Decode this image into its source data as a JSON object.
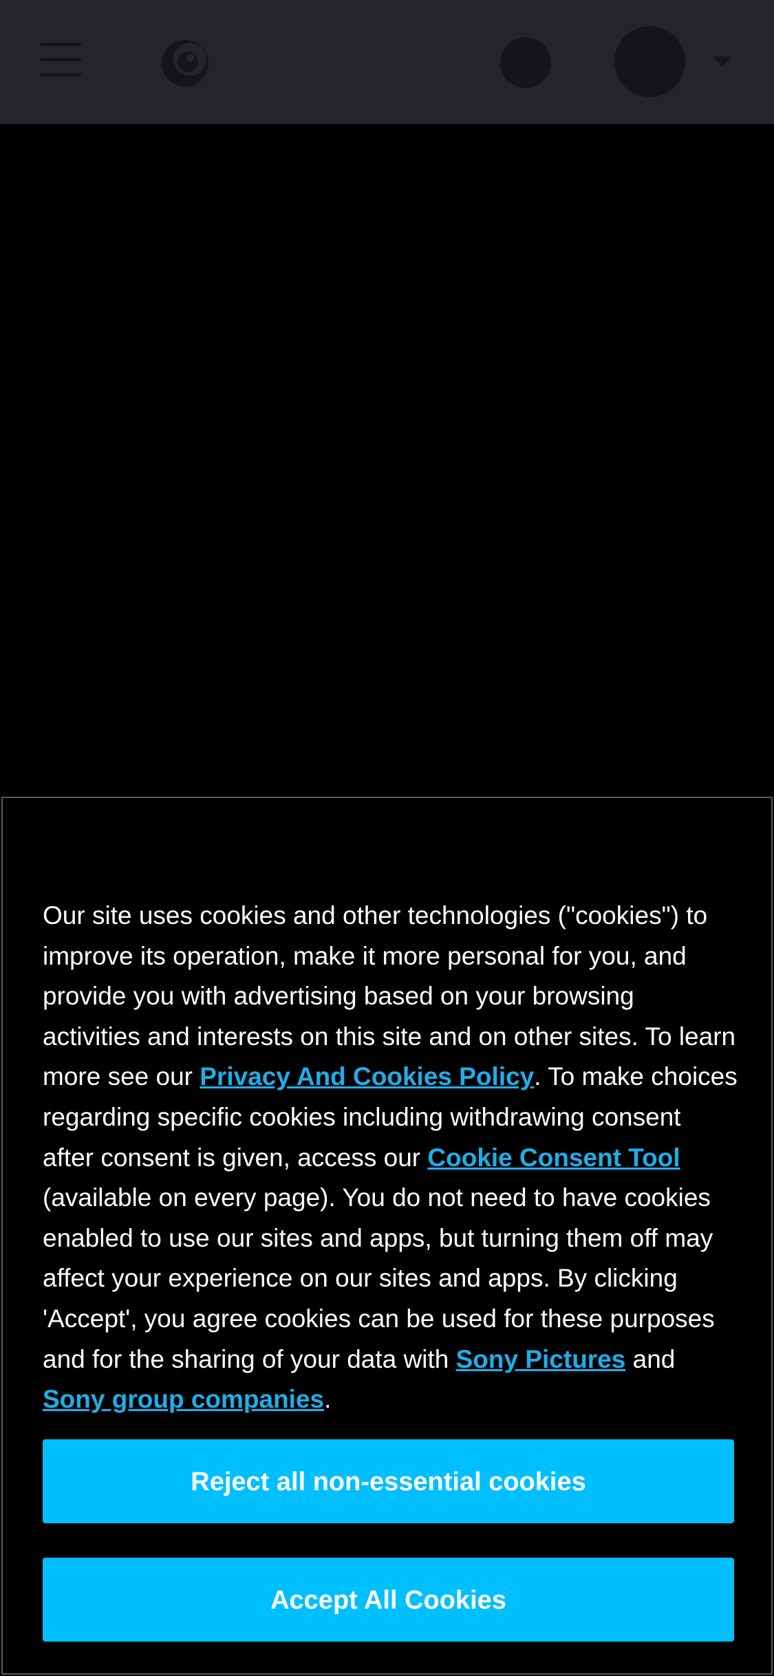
{
  "header": {
    "menu_icon": "hamburger-menu-icon",
    "logo_icon": "crunchyroll-logo-icon",
    "search_icon": "search-icon",
    "avatar_icon": "user-avatar-icon",
    "dropdown_icon": "caret-down-icon",
    "background_color": "#23252b"
  },
  "cookie_banner": {
    "text_part1": "Our site uses cookies and other technologies (\"cookies\") to improve its operation, make it more personal for you, and provide you with advertising based on your browsing activities and interests on this site and on other sites. To learn more see our ",
    "privacy_link": "Privacy And Cookies Policy",
    "text_part2": ". To make choices regarding specific cookies including withdrawing consent after consent is given, access our ",
    "consent_tool_link": "Cookie Consent Tool",
    "text_part3": " (available on every page). You do not need to have cookies enabled to use our sites and apps, but turning them off may affect your experience on our sites and apps. By clicking 'Accept', you agree cookies can be used for these purposes and for the sharing of your data with ",
    "sony_pictures_link": "Sony Pictures",
    "text_and": " and ",
    "sony_group_link": "Sony group companies",
    "text_end": ".",
    "reject_button": "Reject all non-essential cookies",
    "accept_button": "Accept All Cookies",
    "accent_color": "#00bfff",
    "link_color": "#1eaee9"
  }
}
